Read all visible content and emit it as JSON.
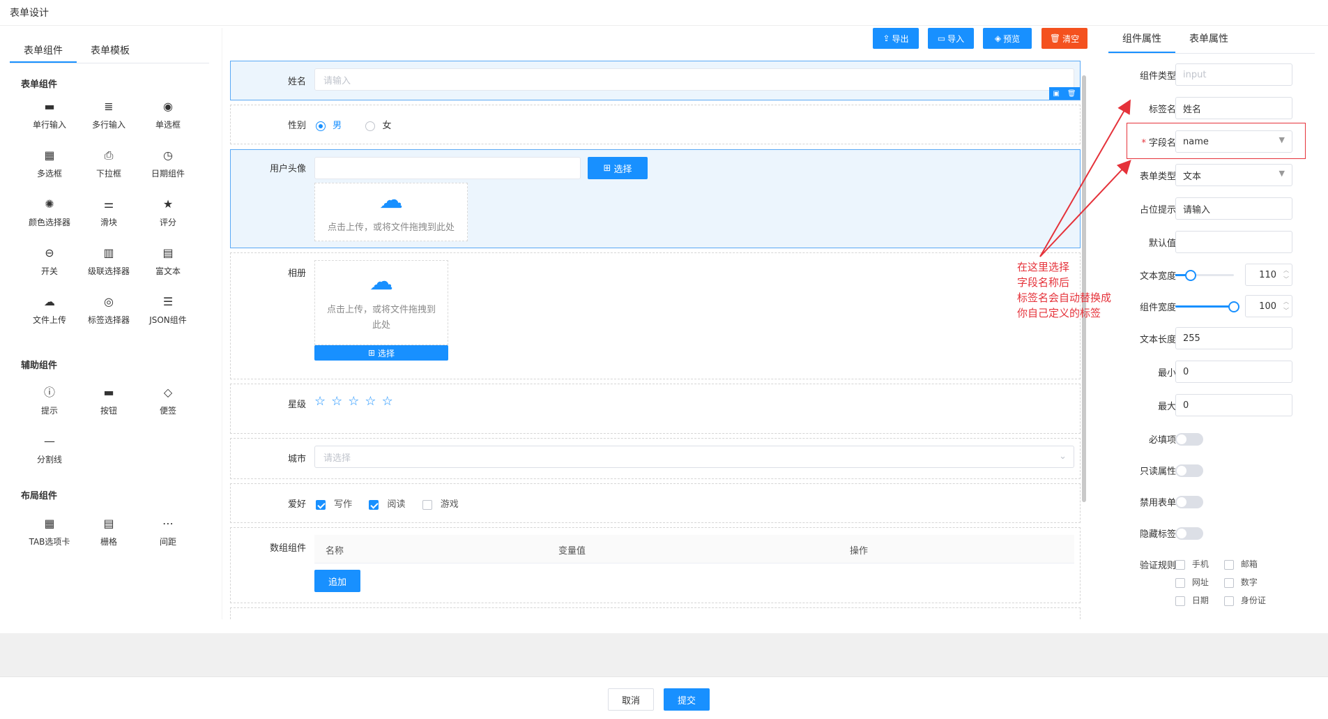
{
  "app": {
    "title": "表单设计"
  },
  "left_panel": {
    "tabs": [
      "表单组件",
      "表单模板"
    ],
    "sections": [
      {
        "title": "表单组件",
        "items": [
          {
            "label": "单行输入",
            "icon": "input-icon"
          },
          {
            "label": "多行输入",
            "icon": "textarea-icon"
          },
          {
            "label": "单选框",
            "icon": "radio-icon"
          },
          {
            "label": "多选框",
            "icon": "checkbox-icon"
          },
          {
            "label": "下拉框",
            "icon": "select-icon"
          },
          {
            "label": "日期组件",
            "icon": "clock-icon"
          },
          {
            "label": "颜色选择器",
            "icon": "palette-icon"
          },
          {
            "label": "滑块",
            "icon": "slider-icon"
          },
          {
            "label": "评分",
            "icon": "star-icon"
          },
          {
            "label": "开关",
            "icon": "switch-icon"
          },
          {
            "label": "级联选择器",
            "icon": "cascader-icon"
          },
          {
            "label": "富文本",
            "icon": "richtext-icon"
          },
          {
            "label": "文件上传",
            "icon": "upload-icon"
          },
          {
            "label": "标签选择器",
            "icon": "tag-select-icon"
          },
          {
            "label": "JSON组件",
            "icon": "json-icon"
          }
        ]
      },
      {
        "title": "辅助组件",
        "items": [
          {
            "label": "提示",
            "icon": "info-icon"
          },
          {
            "label": "按钮",
            "icon": "button-icon"
          },
          {
            "label": "便签",
            "icon": "tag-icon"
          },
          {
            "label": "分割线",
            "icon": "divider-icon"
          }
        ]
      },
      {
        "title": "布局组件",
        "items": [
          {
            "label": "TAB选项卡",
            "icon": "tabs-icon"
          },
          {
            "label": "栅格",
            "icon": "grid-icon"
          },
          {
            "label": "间距",
            "icon": "ellipsis-icon"
          }
        ]
      }
    ]
  },
  "toolbar": {
    "export": "导出",
    "import": "导入",
    "preview": "预览",
    "clear": "清空"
  },
  "canvas": {
    "name": {
      "label": "姓名",
      "placeholder": "请输入"
    },
    "gender": {
      "label": "性别",
      "options": [
        "男",
        "女"
      ],
      "selected": "男"
    },
    "avatar": {
      "label": "用户头像",
      "select": "选择",
      "upload_hint": "点击上传，或将文件拖拽到此处"
    },
    "album": {
      "label": "相册",
      "upload_hint_1": "点击上传，或将文件拖拽到",
      "upload_hint_2": "此处",
      "select": "选择"
    },
    "rating": {
      "label": "星级",
      "value": 0,
      "max": 5
    },
    "city": {
      "label": "城市",
      "placeholder": "请选择"
    },
    "hobby": {
      "label": "爱好",
      "options": [
        {
          "label": "写作",
          "checked": true
        },
        {
          "label": "阅读",
          "checked": true
        },
        {
          "label": "游戏",
          "checked": false
        }
      ]
    },
    "array": {
      "label": "数组组件",
      "columns": [
        "名称",
        "变量值",
        "操作"
      ],
      "add": "追加"
    }
  },
  "right_panel": {
    "tabs": [
      "组件属性",
      "表单属性"
    ],
    "props": {
      "comp_type": {
        "label": "组件类型",
        "value": "input"
      },
      "tag_name": {
        "label": "标签名",
        "value": "姓名"
      },
      "field_name": {
        "label": "字段名",
        "value": "name"
      },
      "form_type": {
        "label": "表单类型",
        "value": "文本"
      },
      "placeholder": {
        "label": "占位提示",
        "value": "请输入"
      },
      "default": {
        "label": "默认值",
        "value": ""
      },
      "text_width": {
        "label": "文本宽度",
        "value": "110"
      },
      "comp_width": {
        "label": "组件宽度",
        "value": "100"
      },
      "text_length": {
        "label": "文本长度",
        "value": "255"
      },
      "min": {
        "label": "最小",
        "value": "0"
      },
      "max": {
        "label": "最大",
        "value": "0"
      },
      "required": {
        "label": "必填项"
      },
      "readonly": {
        "label": "只读属性"
      },
      "disabled": {
        "label": "禁用表单"
      },
      "hide_label": {
        "label": "隐藏标签"
      },
      "rules": {
        "label": "验证规则",
        "options": [
          "手机",
          "邮箱",
          "网址",
          "数字",
          "日期",
          "身份证"
        ]
      }
    }
  },
  "annotation": {
    "lines": [
      "在这里选择",
      "字段名称后",
      "标签名会自动替换成",
      "你自己定义的标签"
    ]
  },
  "footer": {
    "cancel": "取消",
    "submit": "提交"
  }
}
